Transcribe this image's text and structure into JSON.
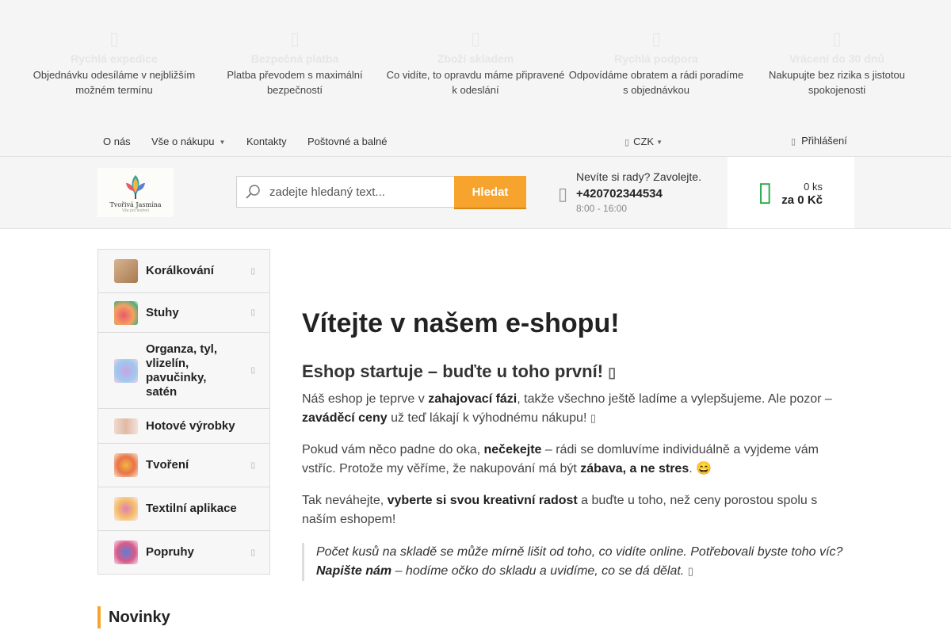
{
  "colors": {
    "accent": "#f6a42e",
    "cart_green": "#27a844",
    "background": "#f5f5f5"
  },
  "benefits": [
    {
      "icon": "truck-icon",
      "title": "Rychlá expedice",
      "text": "Objednávku odesíláme v nejbližším možném termínu"
    },
    {
      "icon": "lock-icon",
      "title": "Bezpečná platba",
      "text": "Platba převodem s maximální bezpečností"
    },
    {
      "icon": "box-icon",
      "title": "Zboží skladem",
      "text": "Co vidíte, to opravdu máme připravené k odeslání"
    },
    {
      "icon": "support-icon",
      "title": "Rychlá podpora",
      "text": "Odpovídáme obratem a rádi poradíme s objednávkou"
    },
    {
      "icon": "return-icon",
      "title": "Vrácení do 30 dnů",
      "text": "Nakupujte bez rizika s jistotou spokojenosti"
    }
  ],
  "topnav": {
    "items": [
      "O nás",
      "Vše o nákupu",
      "Kontakty",
      "Poštovné a balné"
    ],
    "currency": "CZK",
    "login": "Přihlášení"
  },
  "logo": {
    "name": "Tvořivá Jasmína",
    "tagline": "Vše pro tvoření"
  },
  "search": {
    "placeholder": "zadejte hledaný text...",
    "button": "Hledat"
  },
  "contact": {
    "question": "Nevíte si rady? Zavolejte.",
    "phone": "+420702344534",
    "hours": "8:00 - 16:00"
  },
  "cart": {
    "count": "0 ks",
    "total": "za 0 Kč"
  },
  "categories": [
    {
      "label": "Korálkování",
      "has_sub": true,
      "thumb": "#c9a27a"
    },
    {
      "label": "Stuhy",
      "has_sub": true,
      "thumb": "#e85a6b"
    },
    {
      "label": "Organza, tyl, vlizelín, pavučinky, satén",
      "has_sub": true,
      "thumb": "#d9b3e6"
    },
    {
      "label": "Hotové výrobky",
      "has_sub": false,
      "thumb": "#e8c9b8"
    },
    {
      "label": "Tvoření",
      "has_sub": true,
      "thumb": "#f2b640"
    },
    {
      "label": "Textilní aplikace",
      "has_sub": false,
      "thumb": "#e27fb0"
    },
    {
      "label": "Popruhy",
      "has_sub": true,
      "thumb": "#5b7fd6"
    }
  ],
  "main": {
    "title": "Vítejte v našem e-shopu!",
    "subtitle": "Eshop startuje – buďte u toho první!",
    "p1": {
      "a": "Náš eshop je teprve v ",
      "b": "zahajovací fázi",
      "c": ", takže všechno ještě ladíme a vylepšujeme. Ale pozor – ",
      "d": "zaváděcí ceny",
      "e": " už teď lákají k výhodnému nákupu!"
    },
    "p2": {
      "a": "Pokud vám něco padne do oka, ",
      "b": "nečekejte",
      "c": " – rádi se domluvíme individuálně a vyjdeme vám vstříc. Protože my věříme, že nakupování má být ",
      "d": "zábava, a ne stres",
      "e": ". 😄"
    },
    "p3": {
      "a": "Tak neváhejte, ",
      "b": "vyberte si svou kreativní radost",
      "c": " a buďte u toho, než ceny porostou spolu s naším eshopem!"
    },
    "quote": {
      "a": " Počet kusů na skladě se může mírně lišit od toho, co vidíte online. Potřebovali byste toho víc? ",
      "b": "Napište nám",
      "c": " – hodíme očko do skladu a uvidíme, co se dá dělat."
    }
  },
  "novinky": "Novinky"
}
